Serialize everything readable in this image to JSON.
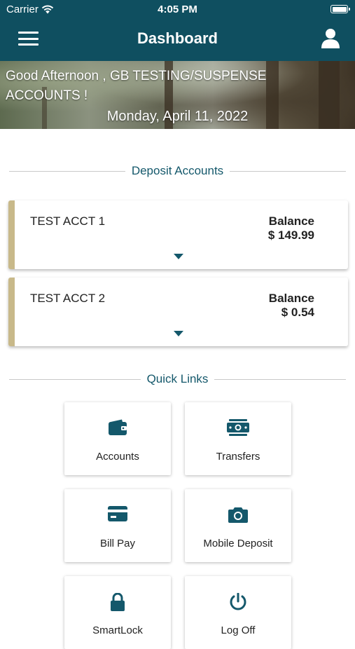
{
  "status_bar": {
    "carrier": "Carrier",
    "time": "4:05 PM"
  },
  "nav": {
    "title": "Dashboard",
    "menu_icon": "hamburger-menu-icon",
    "profile_icon": "user-profile-icon"
  },
  "hero": {
    "greeting": "Good Afternoon , GB TESTING/SUSPENSE ACCOUNTS !",
    "date": "Monday, April 11, 2022"
  },
  "deposit_section": {
    "title": "Deposit Accounts"
  },
  "accounts": [
    {
      "name": "TEST ACCT 1",
      "balance_label": "Balance",
      "balance": "$ 149.99"
    },
    {
      "name": "TEST ACCT 2",
      "balance_label": "Balance",
      "balance": "$ 0.54"
    }
  ],
  "quick_links_section": {
    "title": "Quick Links"
  },
  "quick_links": [
    {
      "label": "Accounts",
      "icon": "wallet-icon"
    },
    {
      "label": "Transfers",
      "icon": "money-transfer-icon"
    },
    {
      "label": "Bill Pay",
      "icon": "credit-card-icon"
    },
    {
      "label": "Mobile Deposit",
      "icon": "camera-icon"
    },
    {
      "label": "SmartLock",
      "icon": "lock-icon"
    },
    {
      "label": "Log Off",
      "icon": "log-off-icon"
    }
  ],
  "colors": {
    "header": "#0f4f60",
    "accent_teal": "#14586b",
    "card_accent": "#c8b98a"
  }
}
